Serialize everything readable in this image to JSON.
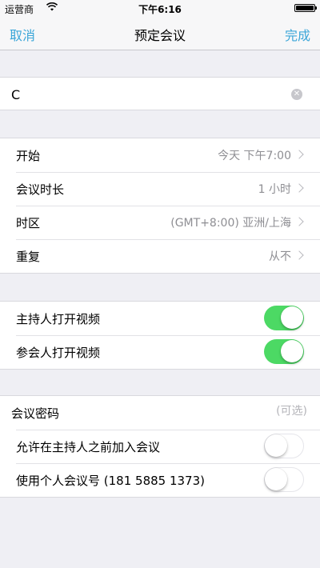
{
  "status_bar": {
    "carrier": "运营商",
    "time": "下午6:16",
    "wifi_icon": "wifi-icon",
    "battery_icon": "battery-icon"
  },
  "nav": {
    "cancel_label": "取消",
    "title": "预定会议",
    "done_label": "完成"
  },
  "topic": {
    "value": "C",
    "clear_icon": "clear-icon"
  },
  "schedule": {
    "items": [
      {
        "label": "开始",
        "value": "今天 下午7:00"
      },
      {
        "label": "会议时长",
        "value": "1 小时"
      },
      {
        "label": "时区",
        "value": "(GMT+8:00) 亚洲/上海"
      },
      {
        "label": "重复",
        "value": "从不"
      }
    ]
  },
  "video": {
    "items": [
      {
        "label": "主持人打开视频",
        "on": true
      },
      {
        "label": "参会人打开视频",
        "on": true
      }
    ]
  },
  "security": {
    "password_label": "会议密码",
    "password_placeholder": "(可选)",
    "password_value": "",
    "items": [
      {
        "label": "允许在主持人之前加入会议",
        "on": false
      },
      {
        "label": "使用个人会议号 (181 5885 1373)",
        "on": false
      }
    ]
  },
  "colors": {
    "accent": "#3ba6d8",
    "toggle_on": "#4cd964",
    "background": "#efeff4"
  }
}
